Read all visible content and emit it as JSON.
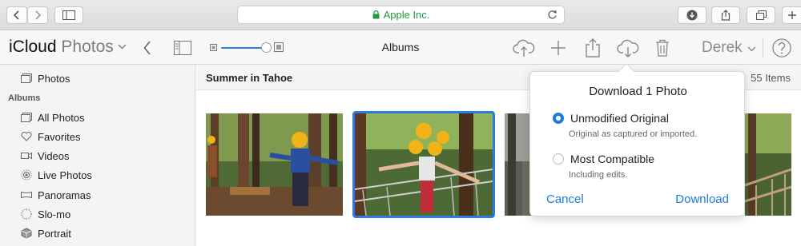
{
  "browser": {
    "url_text": "Apple Inc.",
    "buttons": [
      "back",
      "forward",
      "sidebar",
      "reload",
      "downloads",
      "share",
      "tabs",
      "new-tab"
    ]
  },
  "app": {
    "brand_main": "iCloud",
    "brand_sub": "Photos",
    "view_title": "Albums",
    "user_name": "Derek"
  },
  "sidebar": {
    "top_item": "Photos",
    "section_header": "Albums",
    "items": [
      "All Photos",
      "Favorites",
      "Videos",
      "Live Photos",
      "Panoramas",
      "Slo-mo",
      "Portrait"
    ]
  },
  "content": {
    "album_name": "Summer in Tahoe",
    "item_count": "55 Items"
  },
  "download_popover": {
    "title": "Download 1 Photo",
    "options": [
      {
        "label": "Unmodified Original",
        "description": "Original as captured or imported.",
        "selected": true
      },
      {
        "label": "Most Compatible",
        "description": "Including edits.",
        "selected": false
      }
    ],
    "cancel_label": "Cancel",
    "download_label": "Download"
  },
  "colors": {
    "accent": "#1f7ae0",
    "secure_green": "#1e9a3a"
  }
}
